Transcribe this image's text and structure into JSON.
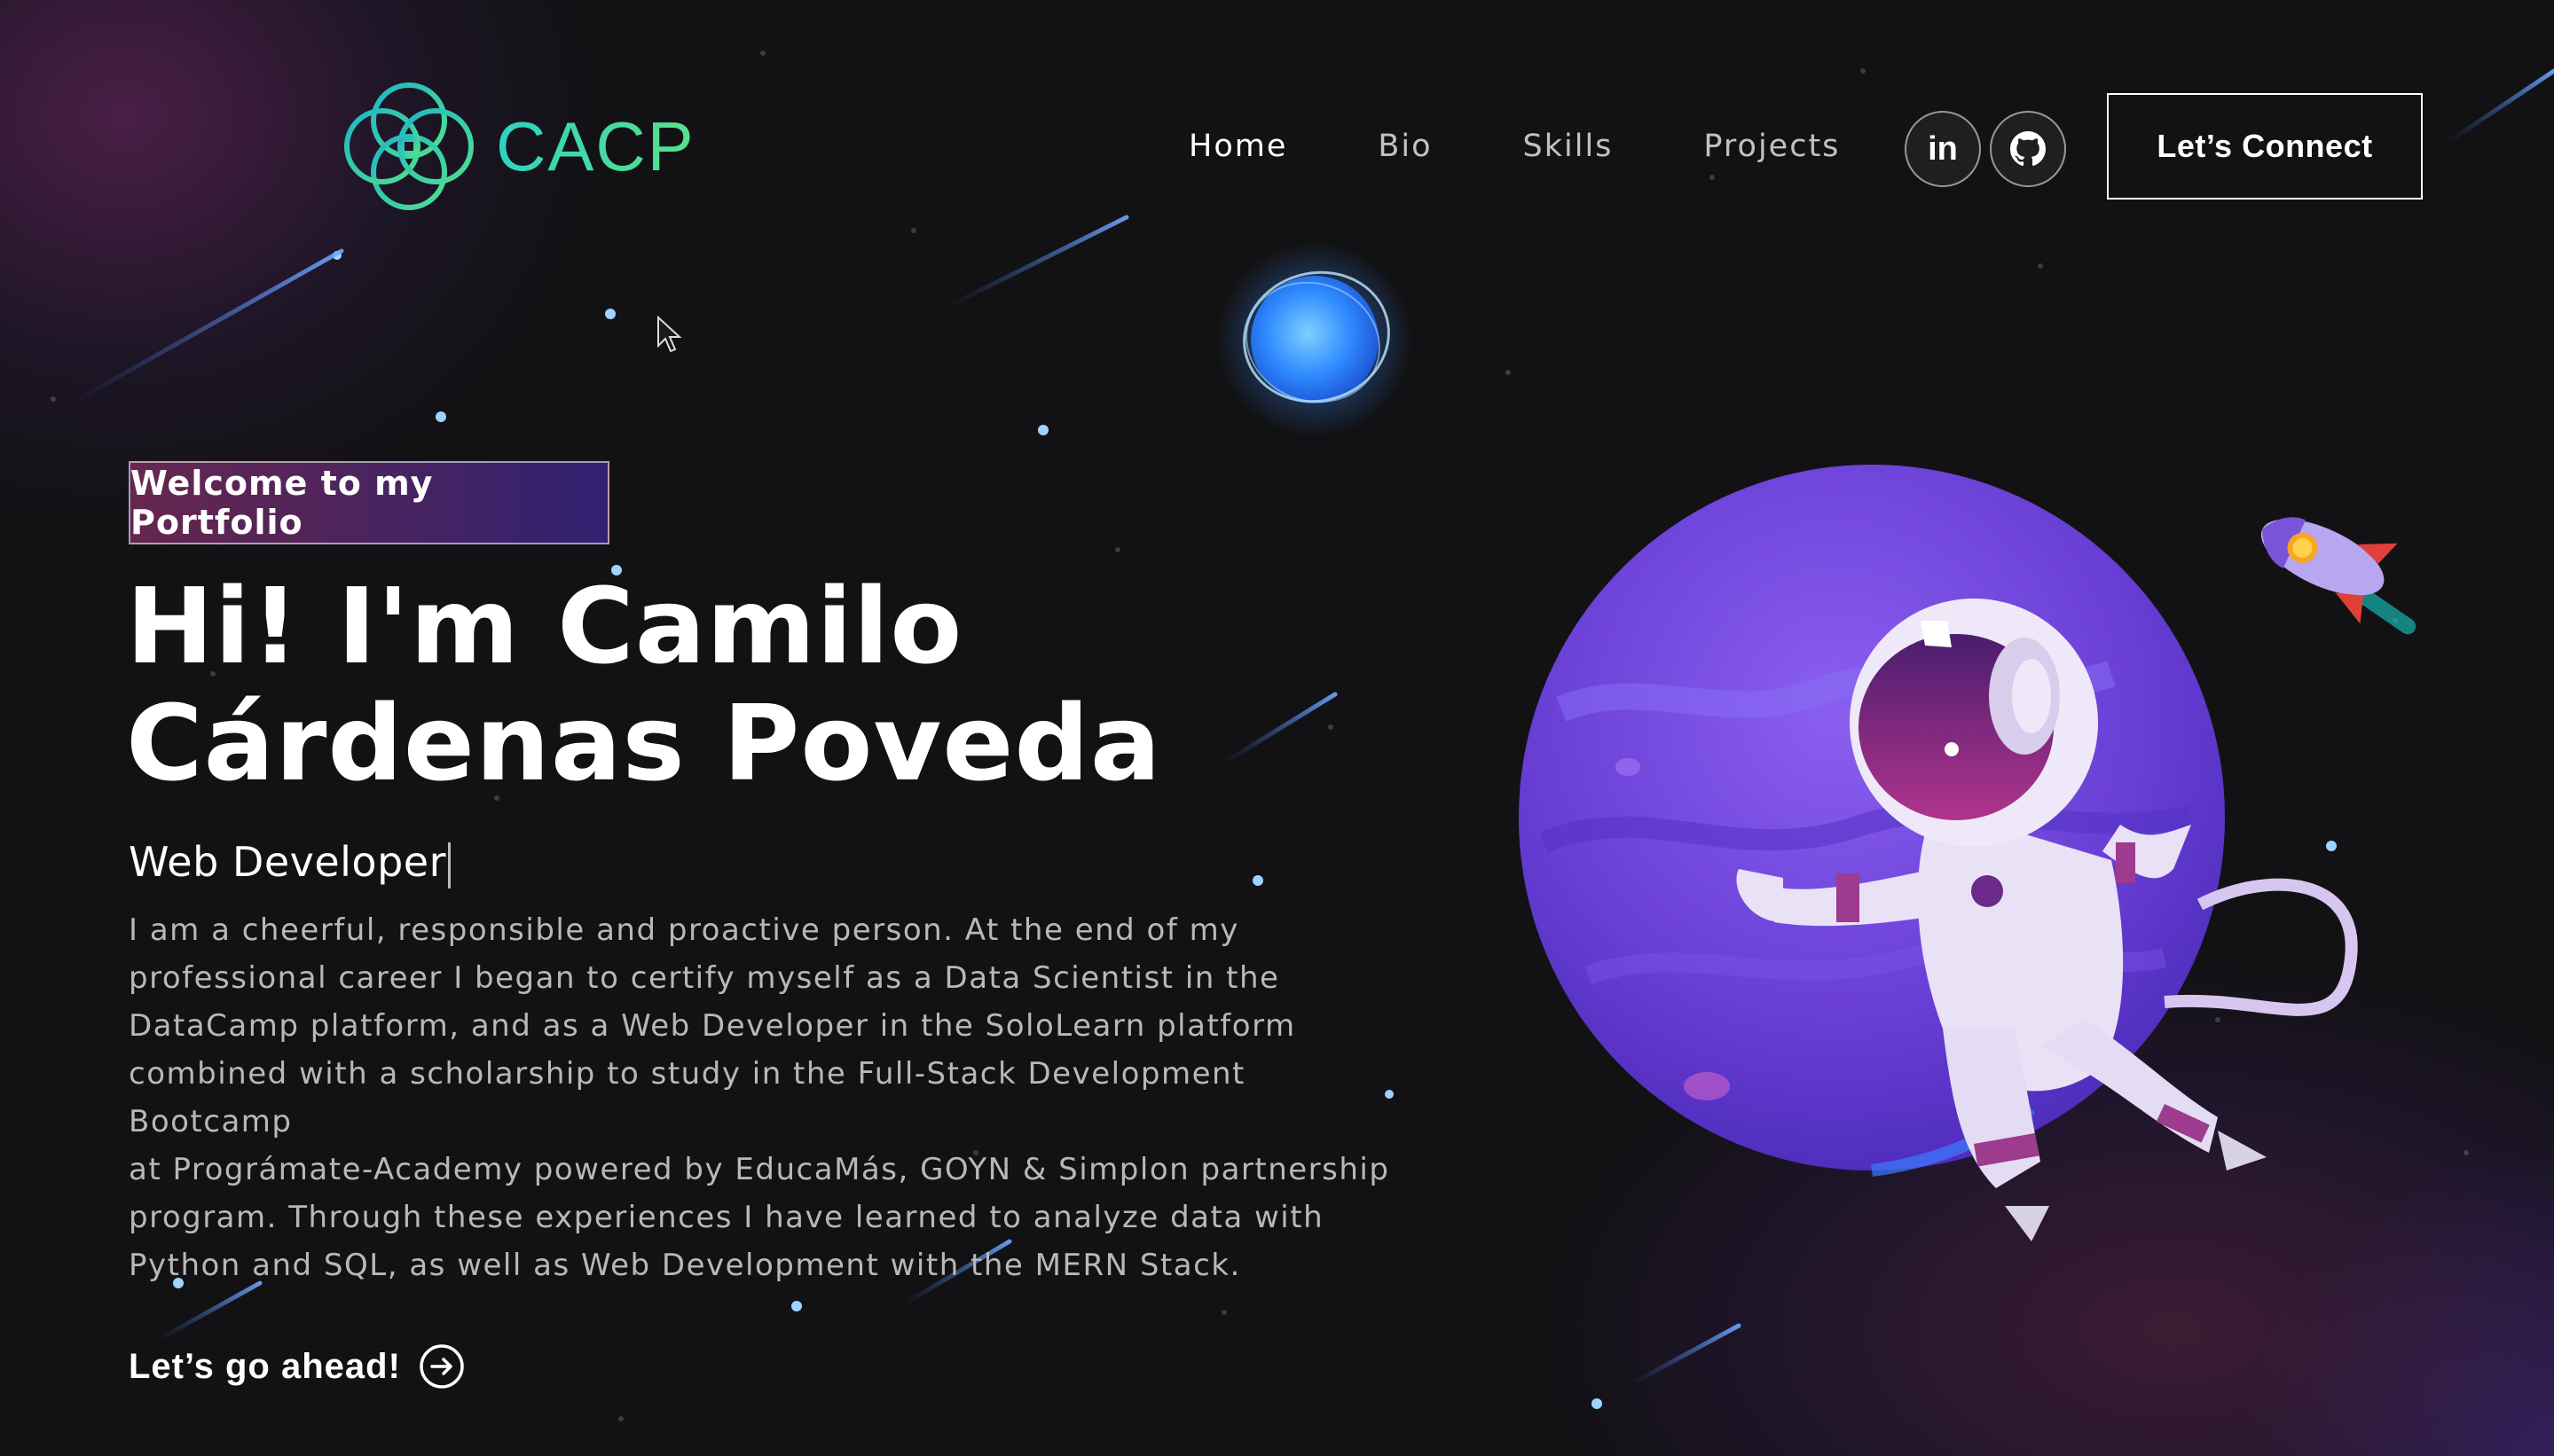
{
  "brand": {
    "name": "CACP",
    "logo_icon": "four-rings-flower-icon"
  },
  "nav": {
    "links": [
      {
        "label": "Home"
      },
      {
        "label": "Bio"
      },
      {
        "label": "Skills"
      },
      {
        "label": "Projects"
      }
    ],
    "social": [
      {
        "icon": "linkedin-icon",
        "text": "in"
      },
      {
        "icon": "github-icon"
      }
    ],
    "cta_label": "Let’s Connect"
  },
  "hero": {
    "badge": "Welcome to my Portfolio",
    "title_line1": "Hi! I'm Camilo",
    "title_line2": "Cárdenas Poveda",
    "role": "Web Developer",
    "bio_lines": [
      "I am a cheerful, responsible and proactive person. At the end of my",
      "professional career I began to certify myself as a Data Scientist in the",
      "DataCamp platform, and as a Web Developer in the SoloLearn platform",
      "combined with a scholarship to study in the Full-Stack Development Bootcamp",
      "at Prográmate-Academy powered by EducaMás, GOYN & Simplon partnership",
      "program. Through these experiences I have learned to analyze data with",
      "Python and SQL, as well as Web Development with the MERN Stack."
    ],
    "cta_label": "Let’s go ahead!"
  },
  "colors": {
    "background": "#121214",
    "logo_gradient_start": "#2ed4c0",
    "logo_gradient_end": "#58e08a",
    "badge_gradient_start": "#aa367c",
    "badge_gradient_end": "#4a2fbd",
    "bio_text": "#b8b8b8"
  },
  "illustrations": [
    "blue-glowing-planet",
    "purple-planet",
    "astronaut",
    "rocket",
    "shooting-stars"
  ]
}
